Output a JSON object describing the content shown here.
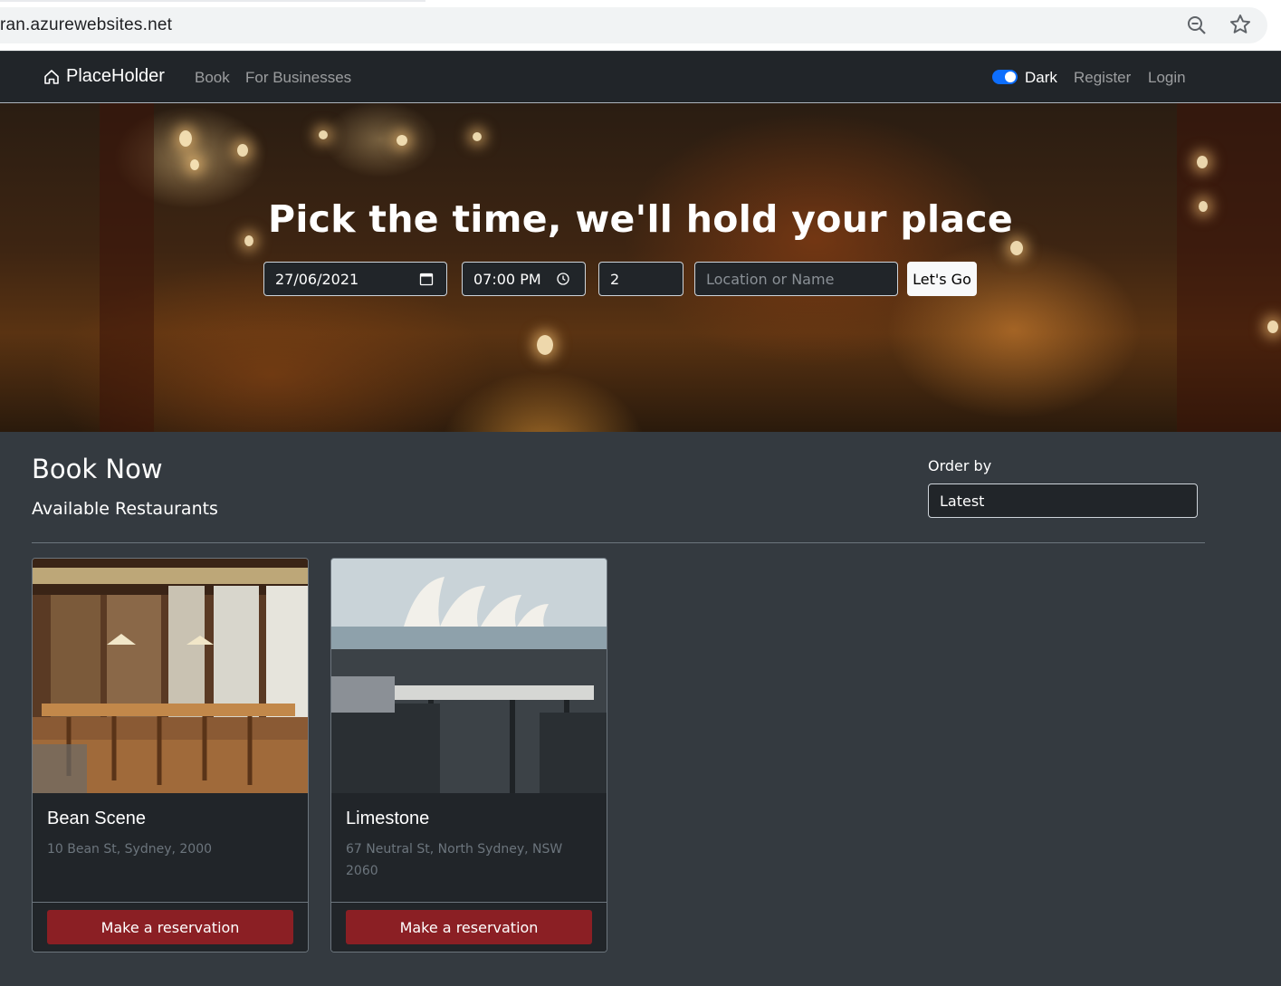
{
  "browser": {
    "url": "ran.azurewebsites.net"
  },
  "navbar": {
    "brand": "PlaceHolder",
    "links": [
      "Book",
      "For Businesses"
    ],
    "theme_toggle_label": "Dark",
    "theme_toggle_on": true,
    "right_links": [
      "Register",
      "Login"
    ]
  },
  "hero": {
    "title": "Pick the time, we'll hold your place",
    "date_value": "27/06/2021",
    "time_value": "07:00 PM",
    "guests_value": "2",
    "search_placeholder": "Location or Name",
    "submit_label": "Let's Go"
  },
  "main": {
    "title": "Book Now",
    "subtitle": "Available Restaurants",
    "order_label": "Order by",
    "order_value": "Latest"
  },
  "restaurants": [
    {
      "name": "Bean Scene",
      "address": "10 Bean St, Sydney, 2000",
      "button": "Make a reservation"
    },
    {
      "name": "Limestone",
      "address": "67 Neutral St, North Sydney, NSW 2060",
      "button": "Make a reservation"
    }
  ],
  "colors": {
    "navbar_bg": "#212529",
    "page_bg": "#343a40",
    "toggle_accent": "#0d6efd",
    "reserve_button": "#8b1f24"
  }
}
